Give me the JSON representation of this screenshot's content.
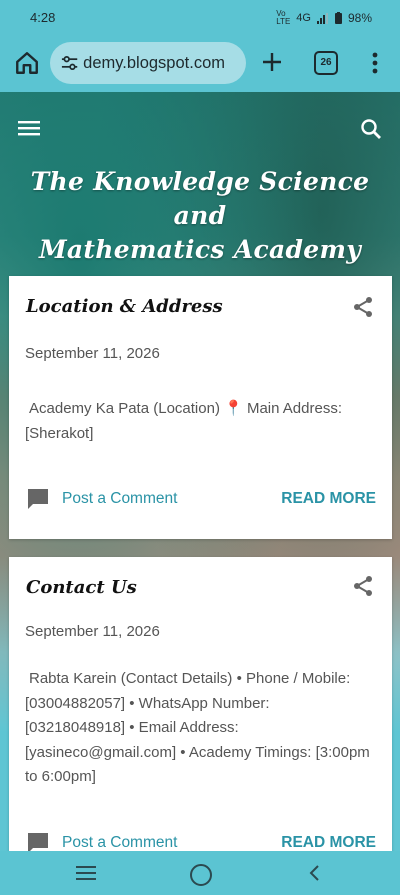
{
  "status": {
    "time": "4:28",
    "network": "4G",
    "battery": "98%"
  },
  "browser": {
    "url": "demy.blogspot.com",
    "tab_count": "26"
  },
  "blog": {
    "title_line1": "The Knowledge Science and",
    "title_line2": "Mathematics Academy"
  },
  "posts": [
    {
      "title": "Location & Address",
      "date": "September 11, 2026",
      "snippet": "Academy Ka Pata (Location) 📍 Main Address: [Sherakot]",
      "comment": "Post a Comment",
      "read_more": "READ MORE"
    },
    {
      "title": "Contact Us",
      "date": "September 11, 2026",
      "snippet": "Rabta Karein (Contact Details) • Phone / Mobile: [03004882057] • WhatsApp Number: [03218048918] • Email Address: [yasineco@gmail.com] • Academy Timings: [3:00pm to 6:00pm]",
      "comment": "Post a Comment",
      "read_more": "READ MORE"
    }
  ],
  "colors": {
    "accent": "#2a93a6",
    "chrome": "#5bc4d2"
  }
}
